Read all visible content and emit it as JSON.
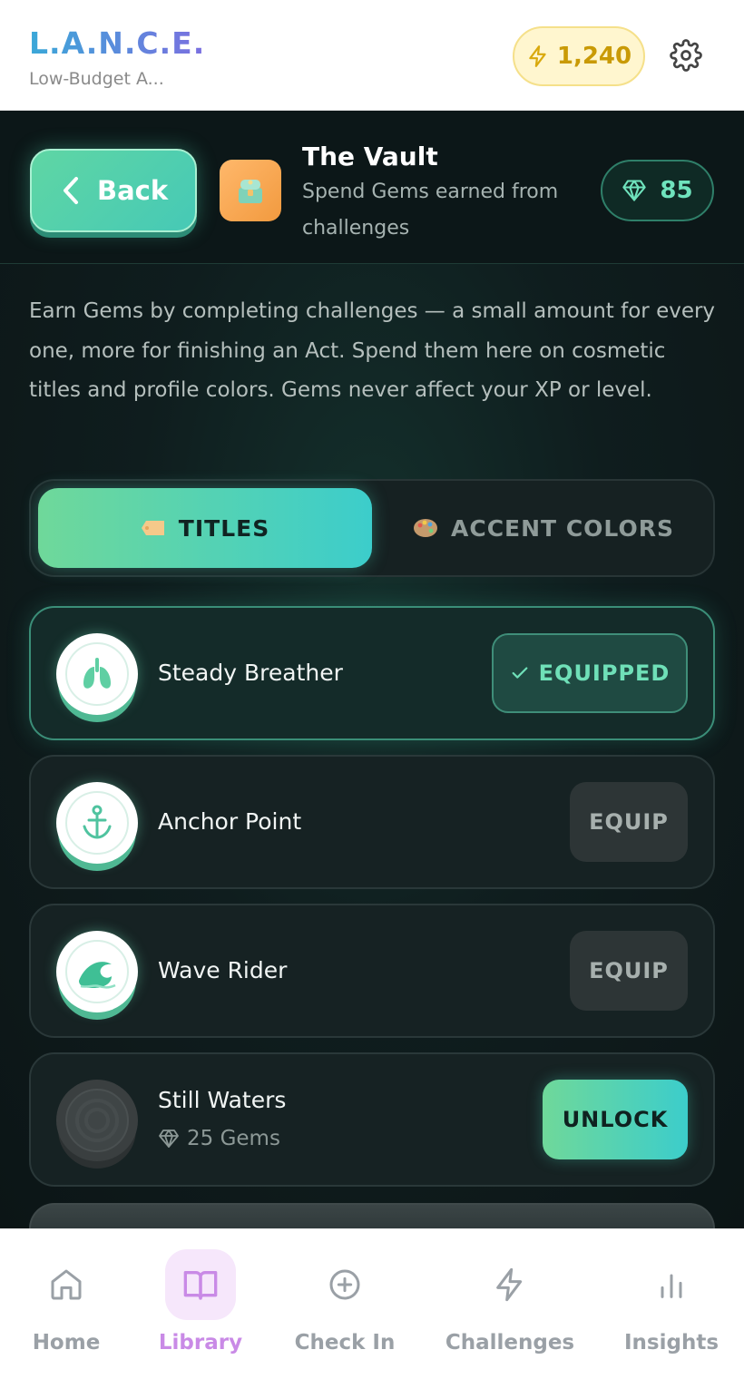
{
  "header": {
    "brand": "L.A.N.C.E.",
    "subtitle": "Low-Budget A...",
    "xp_value": "1,240",
    "icons": {
      "xp": "lightning-icon",
      "settings": "gear-icon"
    }
  },
  "vault": {
    "back_label": "Back",
    "title": "The Vault",
    "subtitle": "Spend Gems earned from challenges",
    "gem_balance": "85",
    "intro": "Earn Gems by completing challenges — a small amount for every one, more for finishing an Act. Spend them here on cosmetic titles and profile colors. Gems never affect your XP or level."
  },
  "tabs": [
    {
      "label": "TITLES",
      "active": true,
      "icon": "tag-icon"
    },
    {
      "label": "ACCENT COLORS",
      "active": false,
      "icon": "palette-icon"
    }
  ],
  "titles": [
    {
      "name": "Steady Breather",
      "state": "EQUIPPED",
      "icon": "lungs-icon"
    },
    {
      "name": "Anchor Point",
      "state": "EQUIP",
      "icon": "anchor-icon"
    },
    {
      "name": "Wave Rider",
      "state": "EQUIP",
      "icon": "wave-icon"
    },
    {
      "name": "Still Waters",
      "state": "UNLOCK",
      "cost": "25 Gems",
      "icon": "ripple-icon"
    }
  ],
  "nav": [
    {
      "label": "Home",
      "icon": "home-icon"
    },
    {
      "label": "Library",
      "icon": "book-icon",
      "active": true
    },
    {
      "label": "Check In",
      "icon": "plus-circle-icon"
    },
    {
      "label": "Challenges",
      "icon": "lightning-icon"
    },
    {
      "label": "Insights",
      "icon": "bar-chart-icon"
    }
  ],
  "colors": {
    "accent_green": "#5fd6a4",
    "accent_teal": "#3ccdcb",
    "xp_gold": "#c99a06",
    "nav_active": "#c98ae6"
  }
}
